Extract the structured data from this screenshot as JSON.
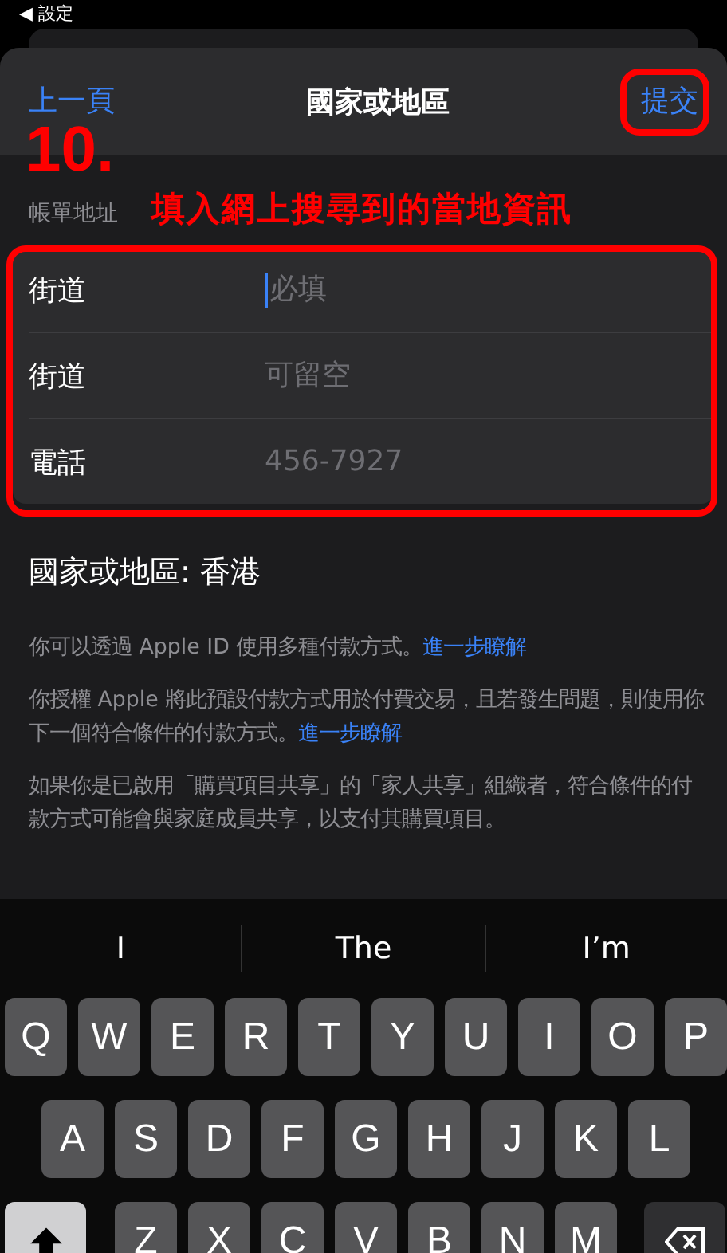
{
  "status_bar": {
    "back_label": "◀ 設定"
  },
  "nav": {
    "back": "上一頁",
    "title": "國家或地區",
    "submit": "提交"
  },
  "annotation": {
    "step": "10.",
    "note": "填入網上搜尋到的當地資訊"
  },
  "section_header": "帳單地址",
  "fields": [
    {
      "label": "街道",
      "placeholder": "必填",
      "focused": true
    },
    {
      "label": "街道",
      "placeholder": "可留空",
      "focused": false
    },
    {
      "label": "電話",
      "placeholder": "456-7927",
      "focused": false
    }
  ],
  "country_line": "國家或地區: 香港",
  "notes": [
    {
      "text": "你可以透過 Apple ID 使用多種付款方式。",
      "link": "進一步瞭解"
    },
    {
      "text": "你授權 Apple 將此預設付款方式用於付費交易，且若發生問題，則使用你下一個符合條件的付款方式。",
      "link": "進一步瞭解"
    },
    {
      "text": "如果你是已啟用「購買項目共享」的「家人共享」組織者，符合條件的付款方式可能會與家庭成員共享，以支付其購買項目。"
    }
  ],
  "suggestions": [
    "I",
    "The",
    "I’m"
  ],
  "keyboard_rows": [
    [
      "Q",
      "W",
      "E",
      "R",
      "T",
      "Y",
      "U",
      "I",
      "O",
      "P"
    ],
    [
      "A",
      "S",
      "D",
      "F",
      "G",
      "H",
      "J",
      "K",
      "L"
    ],
    [
      "Z",
      "X",
      "C",
      "V",
      "B",
      "N",
      "M"
    ]
  ]
}
